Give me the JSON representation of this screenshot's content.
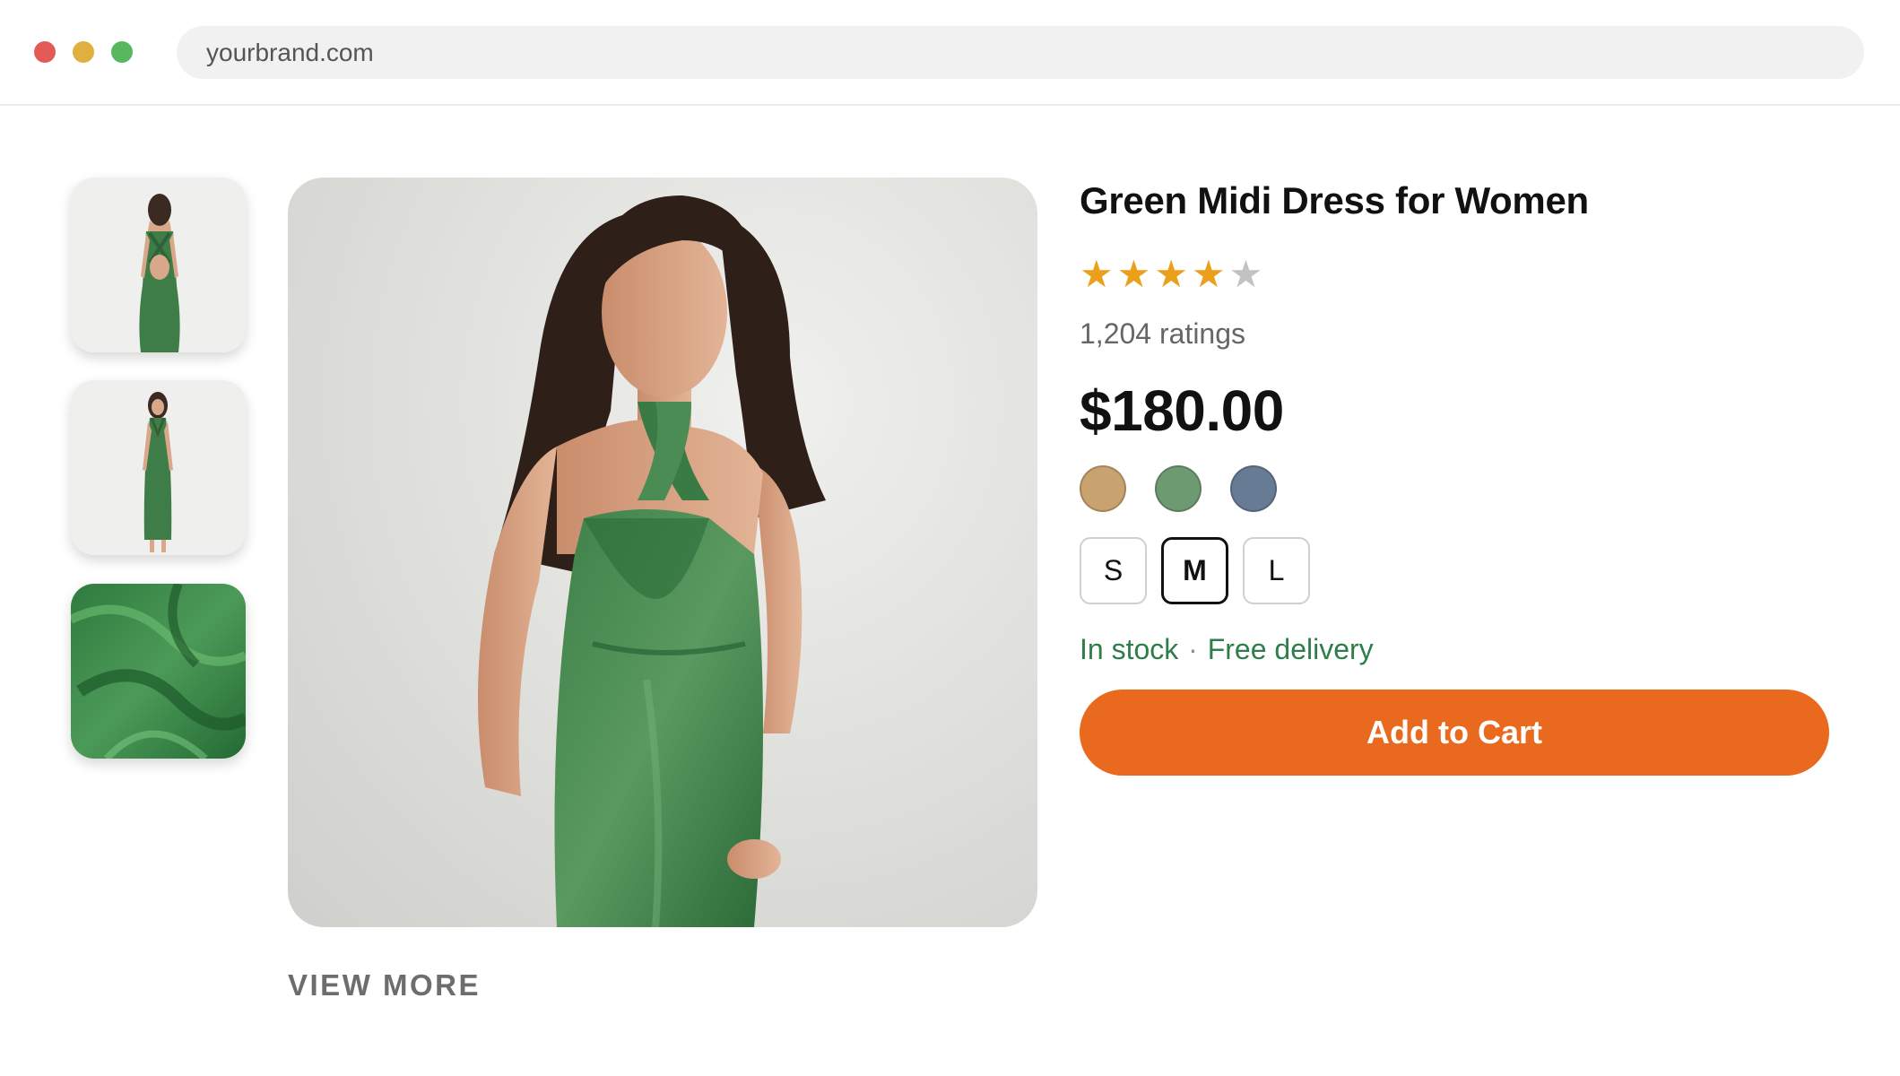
{
  "browser": {
    "url": "yourbrand.com"
  },
  "gallery": {
    "thumbnails": [
      {
        "name": "back-view"
      },
      {
        "name": "full-length-view"
      },
      {
        "name": "fabric-detail"
      }
    ],
    "view_more_label": "VIEW MORE"
  },
  "product": {
    "title": "Green Midi Dress for Women",
    "rating_stars": 4,
    "rating_max": 5,
    "ratings_count": "1,204 ratings",
    "price": "$180.00",
    "colors": [
      {
        "name": "tan",
        "hex": "#c8a36f"
      },
      {
        "name": "sage",
        "hex": "#6e9a72"
      },
      {
        "name": "slate",
        "hex": "#687b94"
      }
    ],
    "sizes": [
      "S",
      "M",
      "L"
    ],
    "selected_size": "M",
    "stock_status": "In stock",
    "stock_separator": "·",
    "delivery": "Free delivery",
    "add_to_cart_label": "Add to Cart"
  },
  "theme": {
    "accent": "#e96a1f",
    "star_color": "#eba01c",
    "stock_color": "#2f7d4a"
  }
}
